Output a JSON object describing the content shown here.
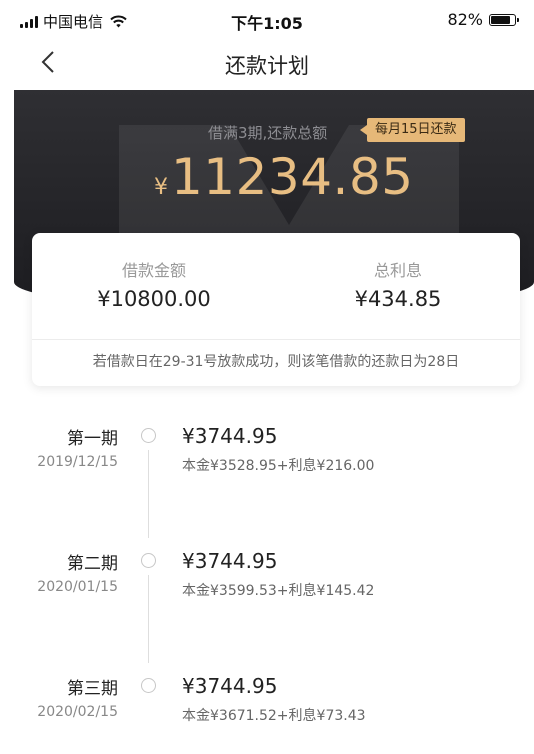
{
  "status_bar": {
    "carrier": "中国电信",
    "time": "下午1:05",
    "battery": "82%",
    "battery_level": 0.82,
    "icons": [
      "signal-icon",
      "wifi-icon",
      "battery-icon"
    ]
  },
  "nav": {
    "title": "还款计划",
    "back_icon": "chevron-left-icon"
  },
  "summary": {
    "caption": "借满3期,还款总额",
    "badge": "每月15日还款",
    "currency": "¥",
    "total": "11234.85"
  },
  "card": {
    "principal_label": "借款金额",
    "principal_value": "¥10800.00",
    "interest_label": "总利息",
    "interest_value": "¥434.85",
    "note": "若借款日在29-31号放款成功，则该笔借款的还款日为28日"
  },
  "periods": [
    {
      "name": "第一期",
      "date": "2019/12/15",
      "amount": "¥3744.95",
      "detail": "本金¥3528.95+利息¥216.00"
    },
    {
      "name": "第二期",
      "date": "2020/01/15",
      "amount": "¥3744.95",
      "detail": "本金¥3599.53+利息¥145.42"
    },
    {
      "name": "第三期",
      "date": "2020/02/15",
      "amount": "¥3744.95",
      "detail": "本金¥3671.52+利息¥73.43"
    }
  ],
  "colors": {
    "banner": "#2a2a2e",
    "gold": "#e8be83",
    "badge_bg": "#e6b878"
  }
}
